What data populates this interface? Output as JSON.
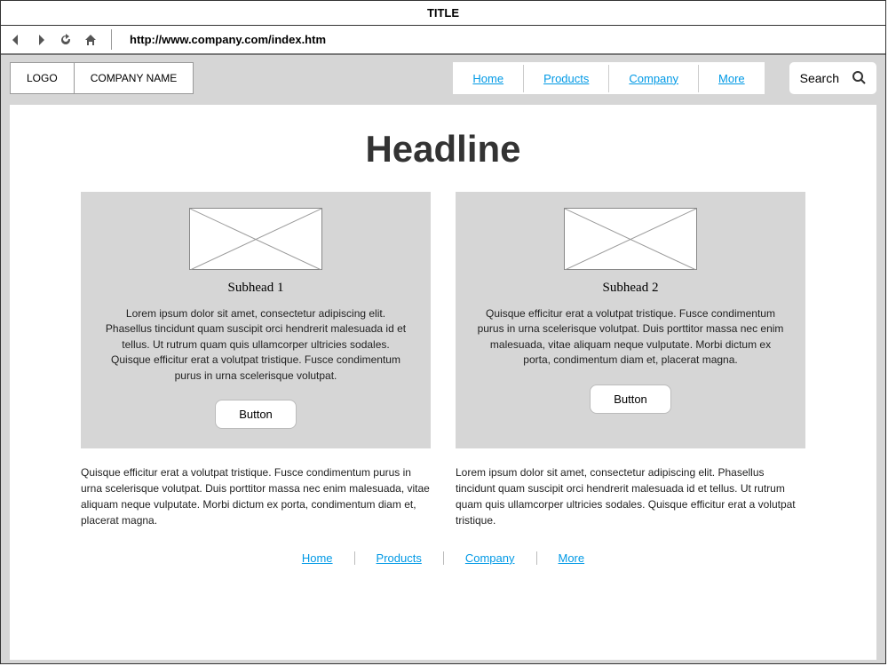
{
  "window": {
    "title": "TITLE"
  },
  "browser": {
    "url": "http://www.company.com/index.htm",
    "icons": {
      "back": "back-icon",
      "forward": "forward-icon",
      "reload": "reload-icon",
      "home": "home-icon"
    }
  },
  "header": {
    "logo": "LOGO",
    "company": "COMPANY NAME",
    "nav": [
      "Home",
      "Products",
      "Company",
      "More"
    ],
    "search_placeholder": "Search"
  },
  "main": {
    "headline": "Headline",
    "cards": [
      {
        "subhead": "Subhead 1",
        "body": "Lorem ipsum dolor sit amet, consectetur adipiscing elit. Phasellus tincidunt quam suscipit orci hendrerit malesuada id et tellus. Ut rutrum quam quis ullamcorper ultricies sodales. Quisque efficitur erat a volutpat tristique. Fusce condimentum purus in urna scelerisque volutpat.",
        "button": "Button"
      },
      {
        "subhead": "Subhead 2",
        "body": "Quisque efficitur erat a volutpat tristique. Fusce condimentum purus in urna scelerisque volutpat. Duis porttitor massa nec enim malesuada, vitae aliquam neque vulputate. Morbi dictum ex porta, condimentum diam et, placerat magna.",
        "button": "Button"
      }
    ],
    "below": [
      "Quisque efficitur erat a volutpat tristique. Fusce condimentum purus in urna scelerisque volutpat. Duis porttitor massa nec enim malesuada, vitae aliquam neque vulputate. Morbi dictum ex porta, condimentum diam et, placerat magna.",
      "Lorem ipsum dolor sit amet, consectetur adipiscing elit. Phasellus tincidunt quam suscipit orci hendrerit malesuada id et tellus. Ut rutrum quam quis ullamcorper ultricies sodales. Quisque efficitur erat a volutpat tristique."
    ]
  },
  "footer": {
    "links": [
      "Home",
      "Products",
      "Company",
      "More"
    ]
  }
}
